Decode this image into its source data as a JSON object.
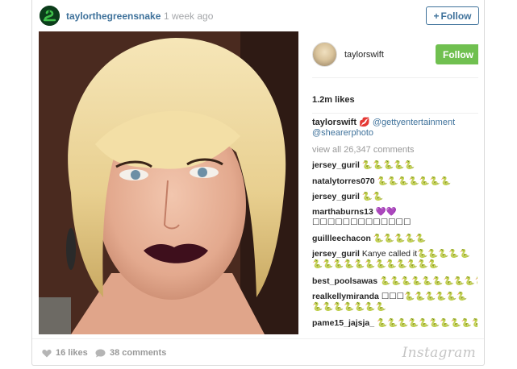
{
  "header": {
    "username": "taylorthegreensnake",
    "time": "1 week ago",
    "follow_label": "Follow",
    "follow_icon": "+"
  },
  "embedded": {
    "username": "taylorswift",
    "follow_label": "Follow",
    "likes": "1.2m likes",
    "caption": {
      "user": "taylorswift",
      "text_emoji": "💋",
      "tag1": "@gettyentertainment",
      "tag2": "@shearerphoto"
    },
    "view_all": "view all 26,347 comments",
    "comments": [
      {
        "user": "jersey_guril",
        "text": "🐍🐍🐍🐍🐍"
      },
      {
        "user": "natalytorres070",
        "text": "🐍🐍🐍🐍🐍🐍🐍"
      },
      {
        "user": "jersey_guril",
        "text": "🐍🐍"
      },
      {
        "user": "marthaburns13",
        "text": "💜💜 ☐☐☐☐☐☐☐☐☐☐☐☐☐"
      },
      {
        "user": "guillleechacon",
        "text": "🐍🐍🐍🐍🐍"
      },
      {
        "user": "jersey_guril",
        "text": "Kanye called it🐍🐍🐍🐍🐍🐍🐍🐍🐍🐍🐍🐍🐍🐍🐍🐍🐍"
      },
      {
        "user": "best_poolsawas",
        "text": "🐍🐍🐍🐍🐍🐍🐍🐍🐍🐍🐍"
      },
      {
        "user": "realkellymiranda",
        "text": "☐☐☐🐍🐍🐍🐍🐍🐍🐍🐍🐍🐍🐍🐍🐍"
      },
      {
        "user": "pame15_jajsja_",
        "text": "🐍🐍🐍🐍🐍🐍🐍🐍🐍🐍"
      }
    ]
  },
  "footer": {
    "likes": "16 likes",
    "comments": "38 comments",
    "logo": "Instagram"
  },
  "colors": {
    "link_blue": "#3f729b",
    "follow_green": "#70c050",
    "muted": "#999999"
  }
}
